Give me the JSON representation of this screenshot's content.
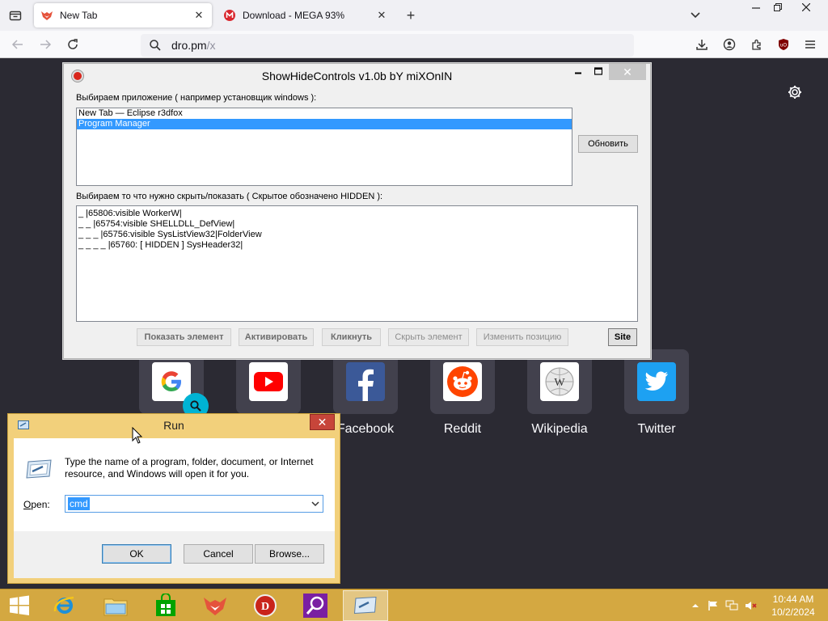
{
  "browser": {
    "tabs": [
      {
        "title": "New Tab",
        "active": true
      },
      {
        "title": "Download - MEGA 93%",
        "active": false
      }
    ],
    "url_host": "dro.pm",
    "url_path": "/x"
  },
  "newtab": {
    "shortcuts": [
      {
        "label": "",
        "icon": "google-icon"
      },
      {
        "label": "",
        "icon": "youtube-icon"
      },
      {
        "label": "Facebook",
        "icon": "facebook-icon"
      },
      {
        "label": "Reddit",
        "icon": "reddit-icon"
      },
      {
        "label": "Wikipedia",
        "icon": "wikipedia-icon"
      },
      {
        "label": "Twitter",
        "icon": "twitter-icon"
      }
    ]
  },
  "shc": {
    "title": "ShowHideControls v1.0b bY miXOnIN",
    "app_label": "Выбираем приложение ( например установщик windows ):",
    "apps": [
      "New Tab — Eclipse r3dfox",
      "Program Manager"
    ],
    "selected_app": "Program Manager",
    "refresh_button": "Обновить",
    "controls_label": "Выбираем то что нужно скрыть/показать ( Скрытое обозначено HIDDEN  ):",
    "controls": [
      "_  |65806:visible WorkerW|",
      "_ _  |65754:visible SHELLDLL_DefView|",
      "_ _ _  |65756:visible SysListView32|FolderView",
      "_ _ _ _  |65760: [ HIDDEN ] SysHeader32|"
    ],
    "buttons": {
      "show": "Показать элемент",
      "activate": "Активировать",
      "click": "Кликнуть",
      "hide": "Скрыть элемент",
      "move": "Изменить позицию",
      "site": "Site"
    }
  },
  "run": {
    "title": "Run",
    "description": "Type the name of a program, folder, document, or Internet resource, and Windows will open it for you.",
    "open_label_accel": "O",
    "open_label_rest": "pen:",
    "open_value": "cmd",
    "ok": "OK",
    "cancel": "Cancel",
    "browse": "Browse..."
  },
  "taskbar": {
    "time": "10:44 AM",
    "date": "10/2/2024"
  },
  "colors": {
    "taskbar": "#d4a841",
    "selection": "#3399ff",
    "newtab_bg": "#2b2a33"
  }
}
